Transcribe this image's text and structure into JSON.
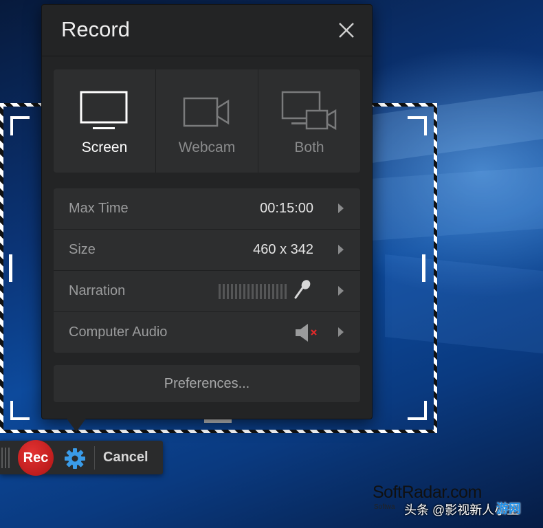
{
  "panel": {
    "title": "Record",
    "close_label": "close"
  },
  "modes": [
    {
      "label": "Screen",
      "icon": "monitor-icon",
      "active": true
    },
    {
      "label": "Webcam",
      "icon": "webcam-icon",
      "active": false
    },
    {
      "label": "Both",
      "icon": "monitor-webcam-icon",
      "active": false
    }
  ],
  "settings": {
    "max_time": {
      "label": "Max Time",
      "value": "00:15:00"
    },
    "size": {
      "label": "Size",
      "value": "460 x 342"
    },
    "narration": {
      "label": "Narration",
      "meter_level": 0,
      "icon": "microphone-icon"
    },
    "computer_audio": {
      "label": "Computer Audio",
      "icon": "speaker-muted-icon",
      "muted": true
    }
  },
  "preferences_label": "Preferences...",
  "toolbar": {
    "rec_label": "Rec",
    "cancel_label": "Cancel",
    "settings_icon": "gear-icon"
  },
  "watermark": {
    "site": "SoftRadar.com",
    "sub": "Softwa",
    "source_line": "头条 @影视新人小王",
    "logo_text": "游网"
  },
  "colors": {
    "panel_bg": "#232425",
    "row_bg": "#2d2e2f",
    "rec_red": "#d11f1f",
    "gear_blue": "#3a9be8"
  }
}
